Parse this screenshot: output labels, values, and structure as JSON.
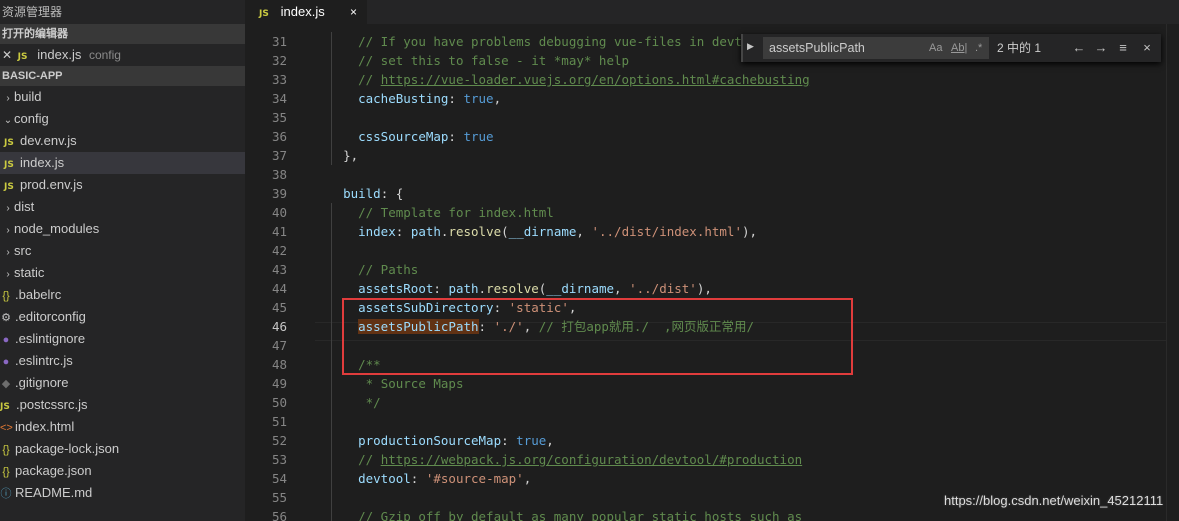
{
  "sidebar": {
    "title": "资源管理器",
    "open_editors_header": "打开的编辑器",
    "open_editor": {
      "badge": "JS",
      "name": "index.js",
      "folder": "config"
    },
    "project_header": "BASIC-APP",
    "tree": [
      {
        "name": "build",
        "type": "folder",
        "expanded": false
      },
      {
        "name": "config",
        "type": "folder",
        "expanded": true
      },
      {
        "name": "dev.env.js",
        "type": "js"
      },
      {
        "name": "index.js",
        "type": "js",
        "selected": true
      },
      {
        "name": "prod.env.js",
        "type": "js"
      },
      {
        "name": "dist",
        "type": "folder",
        "expanded": false
      },
      {
        "name": "node_modules",
        "type": "folder",
        "expanded": false
      },
      {
        "name": "src",
        "type": "folder",
        "expanded": false
      },
      {
        "name": "static",
        "type": "folder",
        "expanded": false
      },
      {
        "name": ".babelrc",
        "type": "json"
      },
      {
        "name": ".editorconfig",
        "type": "gear"
      },
      {
        "name": ".eslintignore",
        "type": "eslint"
      },
      {
        "name": ".eslintrc.js",
        "type": "eslint"
      },
      {
        "name": ".gitignore",
        "type": "git"
      },
      {
        "name": ".postcssrc.js",
        "type": "js"
      },
      {
        "name": "index.html",
        "type": "html"
      },
      {
        "name": "package-lock.json",
        "type": "json"
      },
      {
        "name": "package.json",
        "type": "json"
      },
      {
        "name": "README.md",
        "type": "md"
      }
    ]
  },
  "tab": {
    "badge": "JS",
    "label": "index.js",
    "close": "×"
  },
  "find": {
    "query": "assetsPublicPath",
    "match_case": "Aa",
    "whole_word": "Ab|",
    "regex": ".*",
    "result_count": "2 中的 1",
    "prev": "←",
    "next": "→",
    "in_selection": "≡",
    "close": "×"
  },
  "editor": {
    "first_line_number": 31,
    "current_line": 46,
    "lines": [
      [
        [
          "    ",
          "p"
        ],
        [
          "// If you have problems debugging vue-files in devto",
          "c"
        ]
      ],
      [
        [
          "    ",
          "p"
        ],
        [
          "// set this to false - it *may* help",
          "c"
        ]
      ],
      [
        [
          "    ",
          "p"
        ],
        [
          "// ",
          "c"
        ],
        [
          "https://vue-loader.vuejs.org/en/options.html#cachebusting",
          "lnk"
        ]
      ],
      [
        [
          "    ",
          "p"
        ],
        [
          "cacheBusting",
          "k"
        ],
        [
          ": ",
          "p"
        ],
        [
          "true",
          "b"
        ],
        [
          ",",
          "p"
        ]
      ],
      [
        [
          "",
          "p"
        ]
      ],
      [
        [
          "    ",
          "p"
        ],
        [
          "cssSourceMap",
          "k"
        ],
        [
          ": ",
          "p"
        ],
        [
          "true",
          "b"
        ]
      ],
      [
        [
          "  ",
          "p"
        ],
        [
          "},",
          "p"
        ]
      ],
      [
        [
          "",
          "p"
        ]
      ],
      [
        [
          "  ",
          "p"
        ],
        [
          "build",
          "k"
        ],
        [
          ": {",
          "p"
        ]
      ],
      [
        [
          "    ",
          "p"
        ],
        [
          "// Template for index.html",
          "c"
        ]
      ],
      [
        [
          "    ",
          "p"
        ],
        [
          "index",
          "k"
        ],
        [
          ": ",
          "p"
        ],
        [
          "path",
          "k"
        ],
        [
          ".",
          "p"
        ],
        [
          "resolve",
          "f"
        ],
        [
          "(",
          "p"
        ],
        [
          "__dirname",
          "k"
        ],
        [
          ", ",
          "p"
        ],
        [
          "'../dist/index.html'",
          "s"
        ],
        [
          "),",
          "p"
        ]
      ],
      [
        [
          "",
          "p"
        ]
      ],
      [
        [
          "    ",
          "p"
        ],
        [
          "// Paths",
          "c"
        ]
      ],
      [
        [
          "    ",
          "p"
        ],
        [
          "assetsRoot",
          "k"
        ],
        [
          ": ",
          "p"
        ],
        [
          "path",
          "k"
        ],
        [
          ".",
          "p"
        ],
        [
          "resolve",
          "f"
        ],
        [
          "(",
          "p"
        ],
        [
          "__dirname",
          "k"
        ],
        [
          ", ",
          "p"
        ],
        [
          "'../dist'",
          "s"
        ],
        [
          "),",
          "p"
        ]
      ],
      [
        [
          "    ",
          "p"
        ],
        [
          "assetsSubDirectory",
          "k"
        ],
        [
          ": ",
          "p"
        ],
        [
          "'static'",
          "s"
        ],
        [
          ",",
          "p"
        ]
      ],
      [
        [
          "    ",
          "p"
        ],
        [
          "assetsPublicPath",
          "k hl"
        ],
        [
          ": ",
          "p"
        ],
        [
          "'./'",
          "s"
        ],
        [
          ", ",
          "p"
        ],
        [
          "// 打包app就用./  ,网页版正常用/",
          "c"
        ]
      ],
      [
        [
          "",
          "p"
        ]
      ],
      [
        [
          "    ",
          "p"
        ],
        [
          "/**",
          "c"
        ]
      ],
      [
        [
          "     ",
          "p"
        ],
        [
          "* Source Maps",
          "c"
        ]
      ],
      [
        [
          "     ",
          "p"
        ],
        [
          "*/",
          "c"
        ]
      ],
      [
        [
          "",
          "p"
        ]
      ],
      [
        [
          "    ",
          "p"
        ],
        [
          "productionSourceMap",
          "k"
        ],
        [
          ": ",
          "p"
        ],
        [
          "true",
          "b"
        ],
        [
          ",",
          "p"
        ]
      ],
      [
        [
          "    ",
          "p"
        ],
        [
          "// ",
          "c"
        ],
        [
          "https://webpack.js.org/configuration/devtool/#production",
          "lnk"
        ]
      ],
      [
        [
          "    ",
          "p"
        ],
        [
          "devtool",
          "k"
        ],
        [
          ": ",
          "p"
        ],
        [
          "'#source-map'",
          "s"
        ],
        [
          ",",
          "p"
        ]
      ],
      [
        [
          "",
          "p"
        ]
      ],
      [
        [
          "    ",
          "p"
        ],
        [
          "// Gzip off by default as many popular static hosts such as",
          "c"
        ]
      ]
    ]
  },
  "watermark": "https://blog.csdn.net/weixin_45212111",
  "colors": {
    "sidebar_bg": "#252526",
    "editor_bg": "#1e1e1e",
    "annotation_red": "#e03c3c",
    "js_badge": "#cbcb41"
  }
}
